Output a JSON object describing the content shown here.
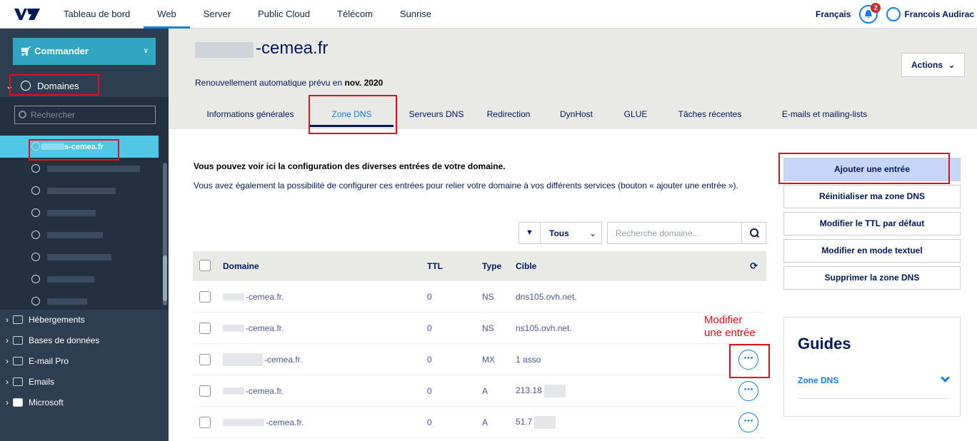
{
  "topnav": {
    "items": [
      "Tableau de bord",
      "Web",
      "Server",
      "Public Cloud",
      "Télécom",
      "Sunrise"
    ],
    "active": "Web",
    "language": "Français",
    "notifications_count": "2",
    "user_name": "Francois Audirac"
  },
  "sidebar": {
    "order_label": "Commander",
    "domains_label": "Domaines",
    "search_placeholder": "Rechercher",
    "active_domain_suffix": "s-cemea.fr",
    "categories": [
      "Hébergements",
      "Bases de données",
      "E-mail Pro",
      "Emails",
      "Microsoft"
    ]
  },
  "header": {
    "domain_suffix": "-cemea.fr",
    "renew_text": "Renouvellement automatique prévu en ",
    "renew_date": "nov. 2020",
    "actions_label": "Actions",
    "tabs": [
      "Informations générales",
      "Zone DNS",
      "Serveurs DNS",
      "Redirection",
      "DynHost",
      "GLUE",
      "Tâches récentes",
      "E-mails et mailing-lists"
    ],
    "active_tab": "Zone DNS"
  },
  "main": {
    "intro_bold": "Vous pouvez voir ici la configuration des diverses entrées de votre domaine.",
    "intro_text": "Vous avez également la possibilité de configurer ces entrées pour relier votre domaine à vos différents services (bouton « ajouter une entrée »).",
    "filter_value": "Tous",
    "search_placeholder": "Recherche domaine...",
    "columns": [
      "Domaine",
      "TTL",
      "Type",
      "Cible"
    ],
    "rows": [
      {
        "domain": "-cemea.fr.",
        "ttl": "0",
        "type": "NS",
        "target": "dns105.ovh.net."
      },
      {
        "domain": "-cemea.fr.",
        "ttl": "0",
        "type": "NS",
        "target": "ns105.ovh.net."
      },
      {
        "domain": "-cemea.fr.",
        "ttl": "0",
        "type": "MX",
        "target": "1 asso"
      },
      {
        "domain": "-cemea.fr.",
        "ttl": "0",
        "type": "A",
        "target": "213.18"
      },
      {
        "domain": "-cemea.fr.",
        "ttl": "0",
        "type": "A",
        "target": "51.7"
      }
    ],
    "annotation_line1": "Modifier",
    "annotation_line2": "une entrée"
  },
  "actions_panel": {
    "buttons": [
      "Ajouter une entrée",
      "Réinitialiser ma zone DNS",
      "Modifier le TTL par défaut",
      "Modifier en mode textuel",
      "Supprimer la zone DNS"
    ]
  },
  "guides": {
    "title": "Guides",
    "link": "Zone DNS"
  },
  "colors": {
    "accent": "#157eea",
    "sidebar_bg": "#2e3e51",
    "highlight": "#e3101c",
    "primary_button": "#c7d5f8"
  }
}
